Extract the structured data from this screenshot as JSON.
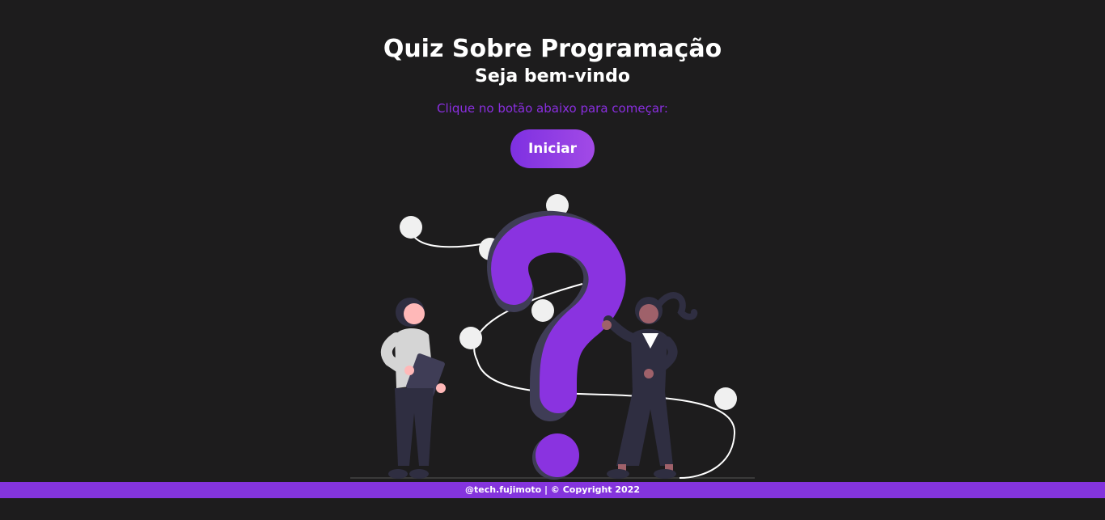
{
  "header": {
    "title": "Quiz Sobre Programação",
    "subtitle": "Seja bem-vindo",
    "instruction": "Clique no botão abaixo para começar:"
  },
  "actions": {
    "start_label": "Iniciar"
  },
  "illustration": {
    "icon": "question-mark-people-illustration"
  },
  "footer": {
    "text": "@tech.fujimoto | © Copyright 2022"
  },
  "colors": {
    "background": "#1d1c1d",
    "accent": "#8434dd",
    "button_gradient_start": "#7e30e1",
    "button_gradient_end": "#a24ae6",
    "text": "#ffffff"
  }
}
